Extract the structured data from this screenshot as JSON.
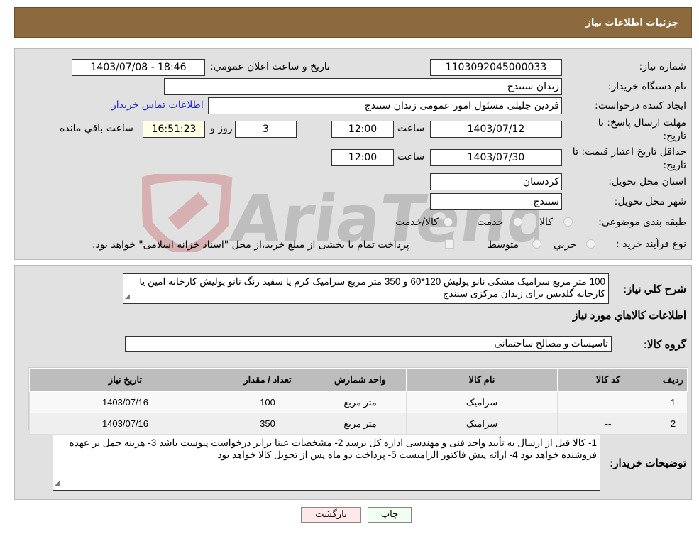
{
  "header": {
    "title": "جزئیات اطلاعات نیاز"
  },
  "form": {
    "need_number_label": "شماره نیاز:",
    "need_number": "1103092045000033",
    "announce_label": "تاريخ و ساعت اعلان عمومي:",
    "announce_value": "1403/07/08 - 18:46",
    "buyer_label": "نام دستگاه خريدار:",
    "buyer_value": "زندان سنندج",
    "creator_label": "ایجاد کننده درخواست:",
    "creator_value": "فردین جلیلی مسئول امور عمومی  زندان سنندج",
    "contact_link": "اطلاعات تماس خريدار",
    "deadline_label": "مهلت ارسال پاسخ: تا تاریخ:",
    "deadline_date": "1403/07/12",
    "time_label": "ساعت",
    "deadline_time": "12:00",
    "days_value": "3",
    "days_label": "روز و",
    "remaining_time": "16:51:23",
    "remaining_label": "ساعت باقي مانده",
    "validity_label": "حداقل تاريخ اعتبار قيمت: تا تاریخ:",
    "validity_date": "1403/07/30",
    "validity_time": "12:00",
    "province_label": "استان محل تحويل:",
    "province_value": "کردستان",
    "city_label": "شهر محل تحويل:",
    "city_value": "سنندج",
    "category_label": "طبقه بندی موضوعی:",
    "category_options": [
      "کالا",
      "خدمت",
      "کالا/خدمت"
    ],
    "process_label": "نوع فرآیند خرید :",
    "process_options": [
      "جزيي",
      "متوسط"
    ],
    "payment_note": "پرداخت تمام یا بخشی از مبلغ خرید،از محل \"اسناد خزانه اسلامی\" خواهد بود."
  },
  "details": {
    "desc_label": "شرح كلي نياز:",
    "desc_value": "100 متر مربع سرامیک مشکی نانو پولیش 120*60 و 350 متر مربع سرامیک کرم یا سفید رنگ نانو پولیش کارخانه امین یا کارخانه گلدیس برای زندان مرکزی سنندج",
    "goods_info_title": "اطلاعات كالاهاي مورد نياز",
    "group_label": "گروه کالا:",
    "group_value": "تاسیسات و مصالح ساختمانی",
    "table": {
      "headers": [
        "رديف",
        "کد کالا",
        "نام کالا",
        "واحد شمارش",
        "تعداد / مقدار",
        "تاریخ نیاز"
      ],
      "rows": [
        [
          "1",
          "--",
          "سرامیک",
          "متر مربع",
          "100",
          "1403/07/16"
        ],
        [
          "2",
          "--",
          "سرامیک",
          "متر مربع",
          "350",
          "1403/07/16"
        ]
      ]
    },
    "notes_label": "توضیحات خریدار:",
    "notes_value": "1- کالا قبل از ارسال به تأیید واحد فنی و مهندسی اداره کل برسد 2- مشخصات عینا برابر درخواست پیوست باشد 3- هزینه حمل بر عهده فروشنده خواهد بود 4- ارائه پیش فاکتور الزامیست 5- پرداخت دو ماه پس از تحویل کالا خواهد بود"
  },
  "buttons": {
    "print": "چاپ",
    "back": "بازگشت"
  },
  "watermark": "AriaTender.neT"
}
